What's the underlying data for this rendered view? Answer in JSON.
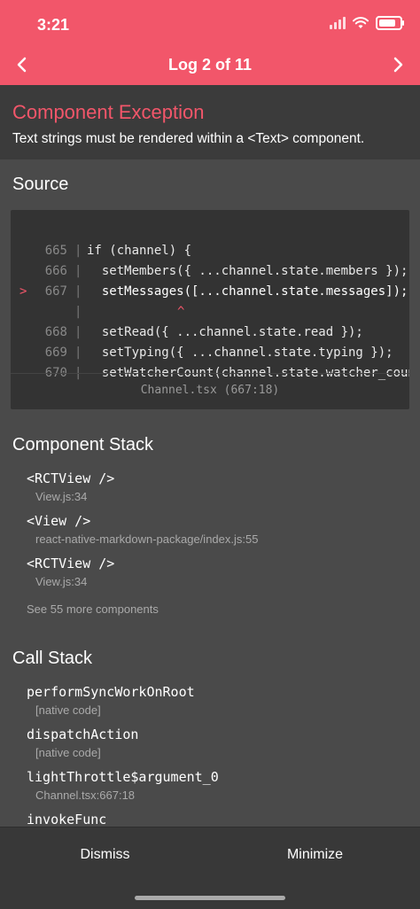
{
  "status_bar": {
    "time": "3:21"
  },
  "nav": {
    "title": "Log 2 of 11",
    "prev_icon": "chevron-left-icon",
    "next_icon": "chevron-right-icon"
  },
  "header": {
    "title": "Component Exception",
    "message": "Text strings must be rendered within a <Text> component."
  },
  "source": {
    "heading": "Source",
    "lines": [
      {
        "marker": "",
        "number": "665",
        "text": "if (channel) {"
      },
      {
        "marker": "",
        "number": "666",
        "text": "  setMembers({ ...channel.state.members });"
      },
      {
        "marker": ">",
        "number": "667",
        "text": "  setMessages([...channel.state.messages]);"
      },
      {
        "marker": "",
        "number": "",
        "text": ""
      },
      {
        "marker": "",
        "number": "668",
        "text": "  setRead({ ...channel.state.read });"
      },
      {
        "marker": "",
        "number": "669",
        "text": "  setTyping({ ...channel.state.typing });"
      },
      {
        "marker": "",
        "number": "670",
        "text": "  setWatcherCount(channel.state.watcher_count"
      }
    ],
    "caret": "^",
    "file": "Channel.tsx (667:18)"
  },
  "component_stack": {
    "heading": "Component Stack",
    "items": [
      {
        "name": "<RCTView />",
        "location": "View.js:34"
      },
      {
        "name": "<View />",
        "location": "react-native-markdown-package/index.js:55"
      },
      {
        "name": "<RCTView />",
        "location": "View.js:34"
      }
    ],
    "see_more": "See 55 more components"
  },
  "call_stack": {
    "heading": "Call Stack",
    "items": [
      {
        "name": "performSyncWorkOnRoot",
        "location": "[native code]"
      },
      {
        "name": "dispatchAction",
        "location": "[native code]"
      },
      {
        "name": "lightThrottle$argument_0",
        "location": "Channel.tsx:667:18"
      },
      {
        "name": "invokeFunc",
        "location": ""
      }
    ]
  },
  "footer": {
    "dismiss": "Dismiss",
    "minimize": "Minimize"
  },
  "colors": {
    "accent": "#f2566a",
    "background": "#4a4a4a",
    "panel": "#333333"
  }
}
